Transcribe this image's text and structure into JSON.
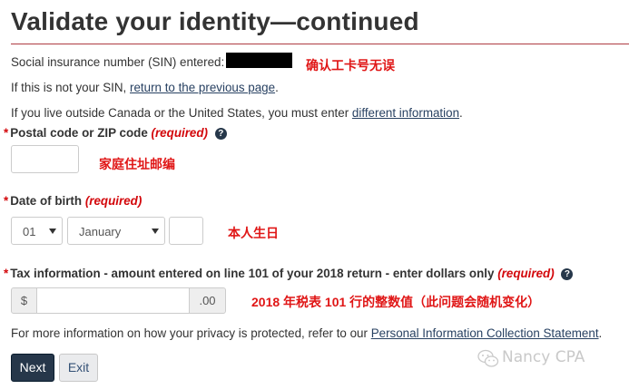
{
  "page": {
    "title": "Validate your identity—continued"
  },
  "sin": {
    "label": "Social insurance number (SIN) entered:",
    "annotation": "确认工卡号无误"
  },
  "notyours": {
    "prefix": "If this is not your SIN,",
    "link": "return to the previous page",
    "suffix": "."
  },
  "outside": {
    "prefix": "If you live outside Canada or the United States, you must enter",
    "link": "different information",
    "suffix": "."
  },
  "postal": {
    "label": "Postal code or ZIP code",
    "required": "(required)",
    "value": "",
    "annotation": "家庭住址邮编"
  },
  "dob": {
    "label": "Date of birth",
    "required": "(required)",
    "day": "01",
    "month": "January",
    "year": "",
    "annotation": "本人生日"
  },
  "tax": {
    "label": "Tax information - amount entered on line 101 of your 2018 return - enter dollars only",
    "required": "(required)",
    "prefix": "$",
    "suffix": ".00",
    "value": "",
    "annotation": "2018 年税表 101 行的整数值（此问题会随机变化）"
  },
  "privacy": {
    "prefix": "For more information on how your privacy is protected, refer to our",
    "link": "Personal Information Collection Statement",
    "suffix": "."
  },
  "buttons": {
    "next": "Next",
    "exit": "Exit"
  },
  "watermark": "Nancy CPA",
  "colors": {
    "title_rule": "#af3c43",
    "required": "#d3080c",
    "annotation": "#e01616",
    "link": "#284162",
    "primary_button": "#26374a"
  }
}
